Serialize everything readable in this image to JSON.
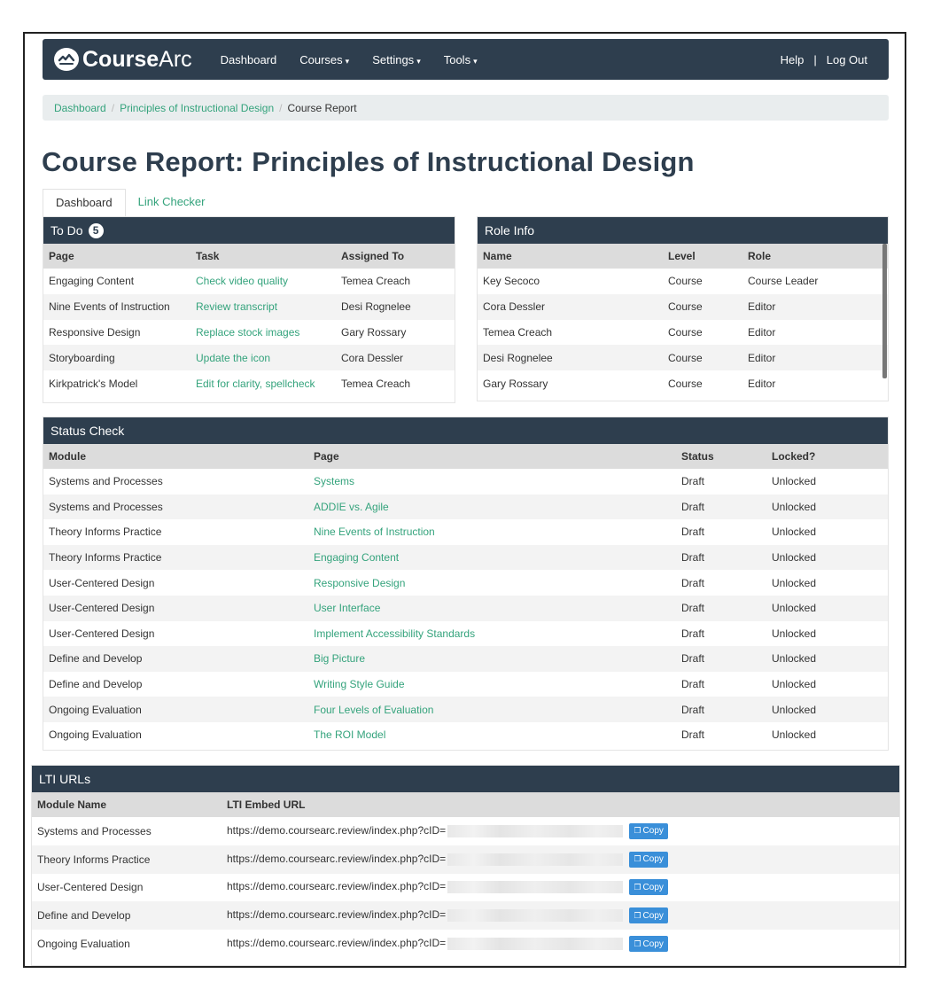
{
  "app": {
    "logo_strong": "Course",
    "logo_light": "Arc"
  },
  "nav": {
    "items": [
      {
        "label": "Dashboard",
        "has_caret": false
      },
      {
        "label": "Courses",
        "has_caret": true
      },
      {
        "label": "Settings",
        "has_caret": true
      },
      {
        "label": "Tools",
        "has_caret": true
      }
    ],
    "help": "Help",
    "separator": "|",
    "logout": "Log Out"
  },
  "breadcrumb": {
    "items": [
      "Dashboard",
      "Principles of Instructional Design",
      "Course Report"
    ],
    "separator": "/"
  },
  "page_title": "Course Report: Principles of Instructional Design",
  "tabs": [
    "Dashboard",
    "Link Checker"
  ],
  "todo": {
    "title": "To Do",
    "count": "5",
    "columns": [
      "Page",
      "Task",
      "Assigned To"
    ],
    "rows": [
      [
        "Engaging Content",
        "Check video quality",
        "Temea Creach"
      ],
      [
        "Nine Events of Instruction",
        "Review transcript",
        "Desi Rognelee"
      ],
      [
        "Responsive Design",
        "Replace stock images",
        "Gary Rossary"
      ],
      [
        "Storyboarding",
        "Update the icon",
        "Cora Dessler"
      ],
      [
        "Kirkpatrick's Model",
        "Edit for clarity, spellcheck",
        "Temea Creach"
      ]
    ]
  },
  "role_info": {
    "title": "Role Info",
    "columns": [
      "Name",
      "Level",
      "Role"
    ],
    "rows": [
      [
        "Key Secoco",
        "Course",
        "Course Leader"
      ],
      [
        "Cora Dessler",
        "Course",
        "Editor"
      ],
      [
        "Temea Creach",
        "Course",
        "Editor"
      ],
      [
        "Desi Rognelee",
        "Course",
        "Editor"
      ],
      [
        "Gary Rossary",
        "Course",
        "Editor"
      ]
    ]
  },
  "status_check": {
    "title": "Status Check",
    "columns": [
      "Module",
      "Page",
      "Status",
      "Locked?"
    ],
    "rows": [
      [
        "Systems and Processes",
        "Systems",
        "Draft",
        "Unlocked"
      ],
      [
        "Systems and Processes",
        "ADDIE vs. Agile",
        "Draft",
        "Unlocked"
      ],
      [
        "Theory Informs Practice",
        "Nine Events of Instruction",
        "Draft",
        "Unlocked"
      ],
      [
        "Theory Informs Practice",
        "Engaging Content",
        "Draft",
        "Unlocked"
      ],
      [
        "User-Centered Design",
        "Responsive Design",
        "Draft",
        "Unlocked"
      ],
      [
        "User-Centered Design",
        "User Interface",
        "Draft",
        "Unlocked"
      ],
      [
        "User-Centered Design",
        "Implement Accessibility Standards",
        "Draft",
        "Unlocked"
      ],
      [
        "Define and Develop",
        "Big Picture",
        "Draft",
        "Unlocked"
      ],
      [
        "Define and Develop",
        "Writing Style Guide",
        "Draft",
        "Unlocked"
      ],
      [
        "Ongoing Evaluation",
        "Four Levels of Evaluation",
        "Draft",
        "Unlocked"
      ],
      [
        "Ongoing Evaluation",
        "The ROI Model",
        "Draft",
        "Unlocked"
      ]
    ]
  },
  "lti": {
    "title": "LTI URLs",
    "columns": [
      "Module Name",
      "LTI Embed URL"
    ],
    "copy_label": "Copy",
    "rows": [
      [
        "Systems and Processes",
        "https://demo.coursearc.review/index.php?cID="
      ],
      [
        "Theory Informs Practice",
        "https://demo.coursearc.review/index.php?cID="
      ],
      [
        "User-Centered Design",
        "https://demo.coursearc.review/index.php?cID="
      ],
      [
        "Define and Develop",
        "https://demo.coursearc.review/index.php?cID="
      ],
      [
        "Ongoing Evaluation",
        "https://demo.coursearc.review/index.php?cID="
      ]
    ]
  },
  "colors": {
    "navy": "#2e3e4e",
    "link_green": "#34a37c",
    "copy_blue": "#3a8fd9"
  }
}
